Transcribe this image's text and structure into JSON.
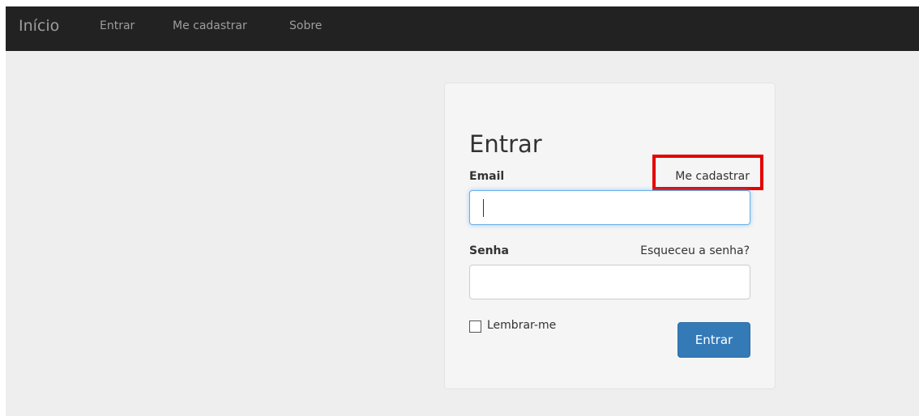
{
  "navbar": {
    "brand": "Início",
    "links": [
      "Entrar",
      "Me cadastrar",
      "Sobre"
    ]
  },
  "form": {
    "title": "Entrar",
    "email_label": "Email",
    "register_link": "Me cadastrar",
    "password_label": "Senha",
    "forgot_link": "Esqueceu a senha?",
    "remember_label": "Lembrar-me",
    "submit_label": "Entrar",
    "email_value": "",
    "password_value": ""
  },
  "colors": {
    "navbar_bg": "#222222",
    "nav_text": "#9d9d9d",
    "page_bg": "#eeeeee",
    "primary_button": "#337ab7",
    "highlight": "#e60000"
  }
}
